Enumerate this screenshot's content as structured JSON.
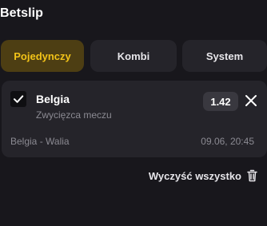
{
  "header": {
    "title": "Betslip"
  },
  "tabs": [
    {
      "label": "Pojedynczy",
      "active": true
    },
    {
      "label": "Kombi",
      "active": false
    },
    {
      "label": "System",
      "active": false
    }
  ],
  "bet": {
    "checked": true,
    "selection": "Belgia",
    "market": "Zwycięzca meczu",
    "odds": "1.42",
    "event": "Belgia - Walia",
    "datetime": "09.06, 20:45"
  },
  "actions": {
    "clear_all_label": "Wyczyść wszystko"
  },
  "colors": {
    "background": "#18171c",
    "card": "#25242a",
    "accent": "#f2c318",
    "active_tab_bg": "#4d3e13",
    "muted_text": "#8b8a92"
  },
  "icons": [
    "check-icon",
    "close-icon",
    "trash-icon"
  ]
}
